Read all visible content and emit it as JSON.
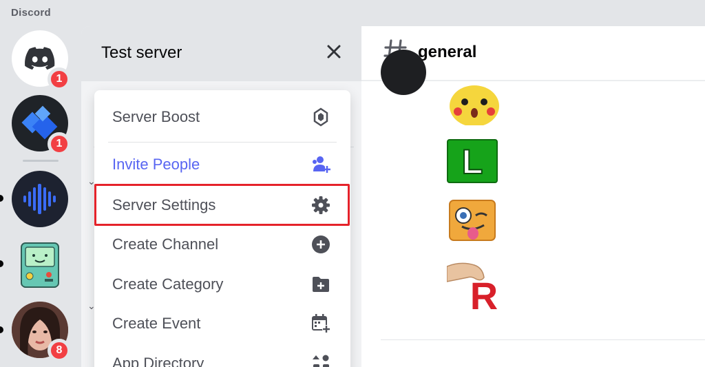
{
  "app": {
    "title": "Discord"
  },
  "rail": {
    "servers": [
      {
        "name": "direct-messages",
        "badge": "1"
      },
      {
        "name": "blue-diamond-server",
        "badge": "1"
      },
      {
        "name": "waveform-server",
        "badge": ""
      },
      {
        "name": "bmo-server",
        "badge": ""
      },
      {
        "name": "portrait-server",
        "badge": "8"
      }
    ]
  },
  "server": {
    "name": "Test server"
  },
  "menu": {
    "items": [
      {
        "label": "Server Boost",
        "icon": "boost-icon"
      },
      {
        "label": "Invite People",
        "icon": "add-person-icon"
      },
      {
        "label": "Server Settings",
        "icon": "gear-icon"
      },
      {
        "label": "Create Channel",
        "icon": "plus-circle-icon"
      },
      {
        "label": "Create Category",
        "icon": "folder-plus-icon"
      },
      {
        "label": "Create Event",
        "icon": "calendar-plus-icon"
      },
      {
        "label": "App Directory",
        "icon": "apps-icon"
      }
    ]
  },
  "chat": {
    "channel": "general",
    "letter_badge": "L",
    "letter_r": "R"
  },
  "colors": {
    "accent": "#5865f2",
    "badge": "#f23f43",
    "highlight": "#e5222a",
    "green": "#16a31a"
  }
}
